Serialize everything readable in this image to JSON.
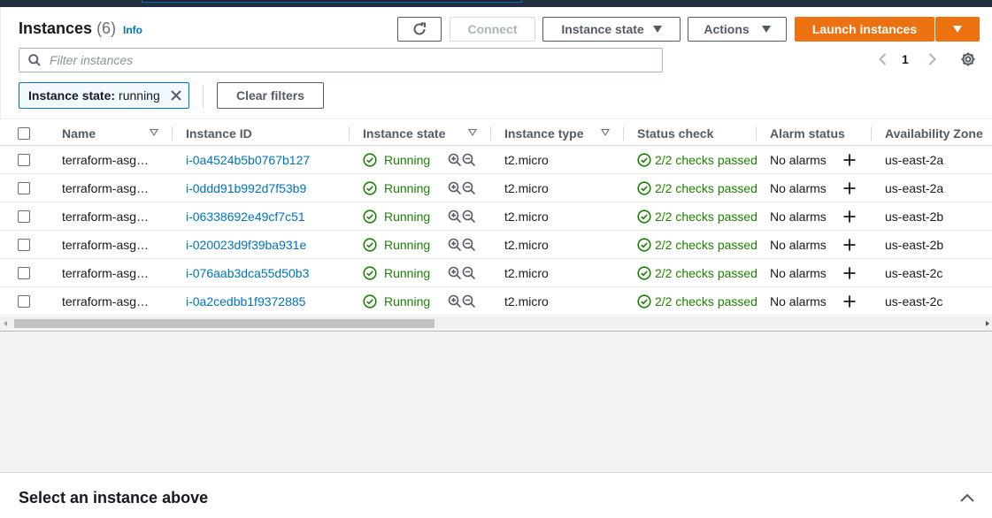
{
  "header": {
    "title": "Instances",
    "count": "(6)",
    "info_link": "Info"
  },
  "toolbar": {
    "refresh_icon": "refresh-icon",
    "connect_label": "Connect",
    "instance_state_label": "Instance state",
    "actions_label": "Actions",
    "launch_label": "Launch instances"
  },
  "search": {
    "placeholder": "Filter instances",
    "value": ""
  },
  "pagination": {
    "current_page": "1"
  },
  "filter_token": {
    "key": "Instance state:",
    "value": "running"
  },
  "clear_filters_label": "Clear filters",
  "table": {
    "columns": [
      "Name",
      "Instance ID",
      "Instance state",
      "Instance type",
      "Status check",
      "Alarm status",
      "Availability Zone"
    ],
    "rows": [
      {
        "name": "terraform-asg…",
        "id": "i-0a4524b5b0767b127",
        "state": "Running",
        "type": "t2.micro",
        "status": "2/2 checks passed",
        "alarm": "No alarms",
        "az": "us-east-2a"
      },
      {
        "name": "terraform-asg…",
        "id": "i-0ddd91b992d7f53b9",
        "state": "Running",
        "type": "t2.micro",
        "status": "2/2 checks passed",
        "alarm": "No alarms",
        "az": "us-east-2a"
      },
      {
        "name": "terraform-asg…",
        "id": "i-06338692e49cf7c51",
        "state": "Running",
        "type": "t2.micro",
        "status": "2/2 checks passed",
        "alarm": "No alarms",
        "az": "us-east-2b"
      },
      {
        "name": "terraform-asg…",
        "id": "i-020023d9f39ba931e",
        "state": "Running",
        "type": "t2.micro",
        "status": "2/2 checks passed",
        "alarm": "No alarms",
        "az": "us-east-2b"
      },
      {
        "name": "terraform-asg…",
        "id": "i-076aab3dca55d50b3",
        "state": "Running",
        "type": "t2.micro",
        "status": "2/2 checks passed",
        "alarm": "No alarms",
        "az": "us-east-2c"
      },
      {
        "name": "terraform-asg…",
        "id": "i-0a2cedbb1f9372885",
        "state": "Running",
        "type": "t2.micro",
        "status": "2/2 checks passed",
        "alarm": "No alarms",
        "az": "us-east-2c"
      }
    ]
  },
  "split_panel": {
    "title": "Select an instance above"
  },
  "colors": {
    "primary": "#ec7211",
    "link": "#0073bb",
    "success": "#1d8102"
  }
}
